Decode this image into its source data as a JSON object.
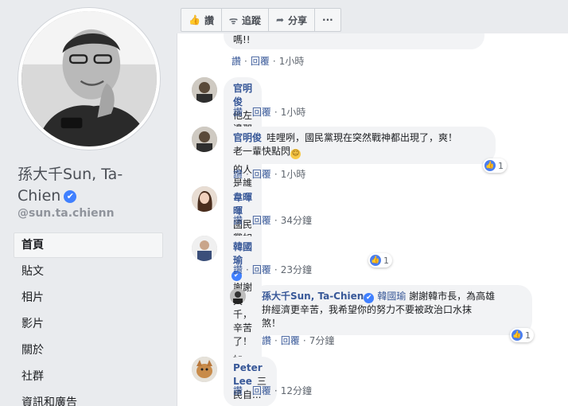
{
  "page": {
    "name": "孫大千Sun, Ta-Chien",
    "handle": "@sun.ta.chienn",
    "verified_mark": "✔"
  },
  "nav": [
    {
      "label": "首頁"
    },
    {
      "label": "貼文"
    },
    {
      "label": "相片"
    },
    {
      "label": "影片"
    },
    {
      "label": "關於"
    },
    {
      "label": "社群"
    },
    {
      "label": "資訊和廣告"
    }
  ],
  "toolbar": {
    "like": "讚",
    "follow": "追蹤",
    "share": "分享",
    "more": "···"
  },
  "actions": {
    "like": "讚",
    "reply": "回覆",
    "dot": "·"
  },
  "comments": [
    {
      "text": "嗎!!",
      "time": "1小時"
    },
    {
      "author": "官明俊",
      "text": "他左邊那個歪嘴巴的人是誰啊，看了好噁心",
      "time": "1小時"
    },
    {
      "author": "官明俊",
      "text": "哇哩咧，國民黨現在突然戰神都出現了，爽！",
      "text2": "老一輩快點閃",
      "emoji": "😄",
      "time": "1小時",
      "likes": "1"
    },
    {
      "author": "韋暉暉",
      "text": "國民黨如果多有你這樣的戰將，未來可期！加油！",
      "time": "34分鐘"
    },
    {
      "author": "韓國瑜",
      "text": "謝謝大千，辛苦了！",
      "time": "23分鐘",
      "likes": "1"
    },
    {
      "author": "孫大千Sun, Ta-Chien",
      "mention": "韓國瑜",
      "text": "謝謝韓市長，為高雄",
      "text2": "拚經濟更辛苦，我希望你的努力不要被政治口水抹",
      "text3": "煞！",
      "time": "7分鐘",
      "likes": "1"
    },
    {
      "author": "Peter Lee",
      "text": "三民自...",
      "time": "12分鐘"
    }
  ],
  "colors": {
    "link": "#385898",
    "background": "#e9ebee",
    "bubble": "#f2f3f5",
    "verified": "#4080ff"
  }
}
